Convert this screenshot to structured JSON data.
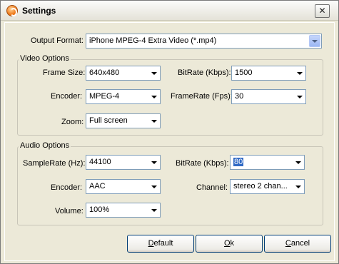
{
  "window": {
    "title": "Settings"
  },
  "output": {
    "label": "Output Format:",
    "value": "iPhone MPEG-4 Extra Video (*.mp4)"
  },
  "video": {
    "group_label": "Video Options",
    "frame_size": {
      "label": "Frame Size:",
      "value": "640x480"
    },
    "encoder": {
      "label": "Encoder:",
      "value": "MPEG-4"
    },
    "zoom": {
      "label": "Zoom:",
      "value": "Full screen"
    },
    "bitrate": {
      "label": "BitRate (Kbps):",
      "value": "1500"
    },
    "framerate": {
      "label": "FrameRate (Fps):",
      "value": "30"
    }
  },
  "audio": {
    "group_label": "Audio Options",
    "samplerate": {
      "label": "SampleRate (Hz):",
      "value": "44100"
    },
    "encoder": {
      "label": "Encoder:",
      "value": "AAC"
    },
    "volume": {
      "label": "Volume:",
      "value": "100%"
    },
    "bitrate": {
      "label": "BitRate (Kbps):",
      "value": "80"
    },
    "channel": {
      "label": "Channel:",
      "value": "stereo 2 chan..."
    }
  },
  "buttons": {
    "default_first": "D",
    "default_rest": "efault",
    "ok_first": "O",
    "ok_rest": "k",
    "cancel_first": "C",
    "cancel_rest": "ancel"
  },
  "icons": {
    "app": "settings-app-icon",
    "close": "close-icon",
    "dropdown": "chevron-down-icon"
  }
}
